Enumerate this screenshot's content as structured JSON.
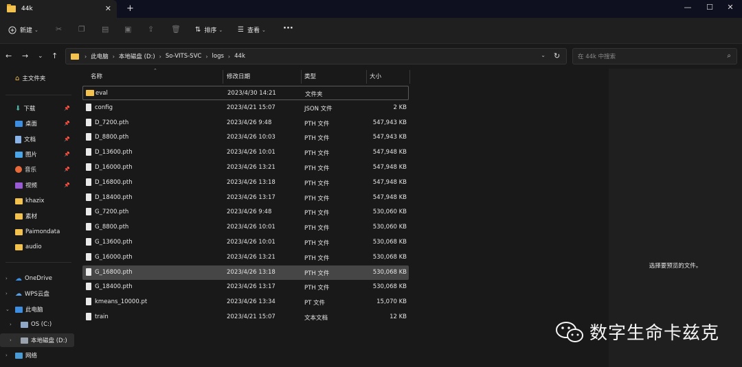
{
  "tab": {
    "title": "44k",
    "close": "✕",
    "add": "+"
  },
  "window": {
    "minimize": "—",
    "maximize": "☐",
    "close": "✕"
  },
  "toolbar": {
    "new_label": "新建",
    "sort_label": "排序",
    "view_label": "查看",
    "more": "···"
  },
  "address": {
    "crumbs": [
      "此电脑",
      "本地磁盘 (D:)",
      "So-VITS-SVC",
      "logs",
      "44k"
    ],
    "search_placeholder": "在 44k 中搜索"
  },
  "sidebar": {
    "home": "主文件夹",
    "quick": [
      {
        "label": "下载",
        "pinned": true
      },
      {
        "label": "桌面",
        "pinned": true
      },
      {
        "label": "文档",
        "pinned": true
      },
      {
        "label": "图片",
        "pinned": true
      },
      {
        "label": "音乐",
        "pinned": true
      },
      {
        "label": "视频",
        "pinned": true
      },
      {
        "label": "khazix"
      },
      {
        "label": "素材"
      },
      {
        "label": "Paimondata"
      },
      {
        "label": "audio"
      }
    ],
    "tree": [
      {
        "label": "OneDrive"
      },
      {
        "label": "WPS云盘"
      },
      {
        "label": "此电脑"
      },
      {
        "label": "OS (C:)"
      },
      {
        "label": "本地磁盘 (D:)"
      },
      {
        "label": "网络"
      }
    ]
  },
  "columns": {
    "name": "名称",
    "modified": "修改日期",
    "type": "类型",
    "size": "大小"
  },
  "files": [
    {
      "name": "eval",
      "modified": "2023/4/30 14:21",
      "type": "文件夹",
      "size": "",
      "kind": "folder"
    },
    {
      "name": "config",
      "modified": "2023/4/21 15:07",
      "type": "JSON 文件",
      "size": "2 KB",
      "kind": "file"
    },
    {
      "name": "D_7200.pth",
      "modified": "2023/4/26 9:48",
      "type": "PTH 文件",
      "size": "547,943 KB",
      "kind": "file"
    },
    {
      "name": "D_8800.pth",
      "modified": "2023/4/26 10:03",
      "type": "PTH 文件",
      "size": "547,943 KB",
      "kind": "file"
    },
    {
      "name": "D_13600.pth",
      "modified": "2023/4/26 10:01",
      "type": "PTH 文件",
      "size": "547,948 KB",
      "kind": "file"
    },
    {
      "name": "D_16000.pth",
      "modified": "2023/4/26 13:21",
      "type": "PTH 文件",
      "size": "547,948 KB",
      "kind": "file"
    },
    {
      "name": "D_16800.pth",
      "modified": "2023/4/26 13:18",
      "type": "PTH 文件",
      "size": "547,948 KB",
      "kind": "file"
    },
    {
      "name": "D_18400.pth",
      "modified": "2023/4/26 13:17",
      "type": "PTH 文件",
      "size": "547,948 KB",
      "kind": "file"
    },
    {
      "name": "G_7200.pth",
      "modified": "2023/4/26 9:48",
      "type": "PTH 文件",
      "size": "530,060 KB",
      "kind": "file"
    },
    {
      "name": "G_8800.pth",
      "modified": "2023/4/26 10:01",
      "type": "PTH 文件",
      "size": "530,060 KB",
      "kind": "file"
    },
    {
      "name": "G_13600.pth",
      "modified": "2023/4/26 10:01",
      "type": "PTH 文件",
      "size": "530,068 KB",
      "kind": "file"
    },
    {
      "name": "G_16000.pth",
      "modified": "2023/4/26 13:21",
      "type": "PTH 文件",
      "size": "530,068 KB",
      "kind": "file"
    },
    {
      "name": "G_16800.pth",
      "modified": "2023/4/26 13:18",
      "type": "PTH 文件",
      "size": "530,068 KB",
      "kind": "file",
      "selected": true
    },
    {
      "name": "G_18400.pth",
      "modified": "2023/4/26 13:17",
      "type": "PTH 文件",
      "size": "530,068 KB",
      "kind": "file"
    },
    {
      "name": "kmeans_10000.pt",
      "modified": "2023/4/26 13:34",
      "type": "PT 文件",
      "size": "15,070 KB",
      "kind": "file"
    },
    {
      "name": "train",
      "modified": "2023/4/21 15:07",
      "type": "文本文档",
      "size": "12 KB",
      "kind": "file"
    }
  ],
  "preview": {
    "message": "选择要预览的文件。"
  },
  "watermark": {
    "text": "数字生命卡兹克"
  },
  "colors": {
    "folder": "#f2c14e",
    "accent_onedrive": "#3a8ee6",
    "selection": "#464646"
  }
}
